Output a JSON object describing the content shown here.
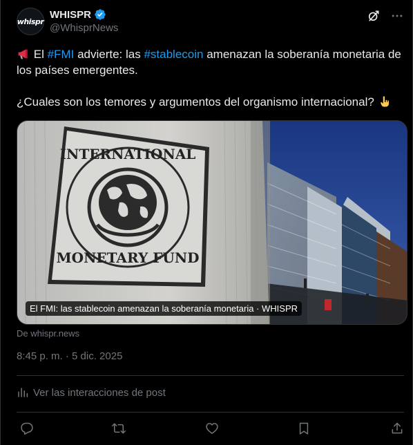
{
  "author": {
    "avatar_text": "whispr",
    "name": "WHISPR",
    "handle": "@WhisprNews",
    "verified": true
  },
  "icons": {
    "grok": "grok-icon",
    "more": "more-horizontal-icon",
    "megaphone": "megaphone-emoji",
    "pointing_down": "pointing-down-emoji"
  },
  "tweet": {
    "line1_pre": "El",
    "hashtag_fmi": "#FMI",
    "line1_mid": "advierte: las",
    "hashtag_stablecoin": "#stablecoin",
    "line1_post": "amenazan la soberanía monetaria de los países emergentes.",
    "line2": "¿Cuales son los temores y argumentos del organismo internacional?"
  },
  "media": {
    "caption": "El FMI: las stablecoin amenazan la soberanía monetaria · WHISPR",
    "seal_top_text": "INTERNATIONAL",
    "seal_bottom_text": "MONETARY FUND"
  },
  "source_text": "De whispr.news",
  "timestamp": "8:45 p. m. · 5 dic. 2025",
  "interactions_label": "Ver las interacciones de post",
  "colors": {
    "background": "#000000",
    "text": "#e7e9ea",
    "secondary": "#71767b",
    "accent": "#1d9bf0",
    "border": "#2f3336"
  }
}
